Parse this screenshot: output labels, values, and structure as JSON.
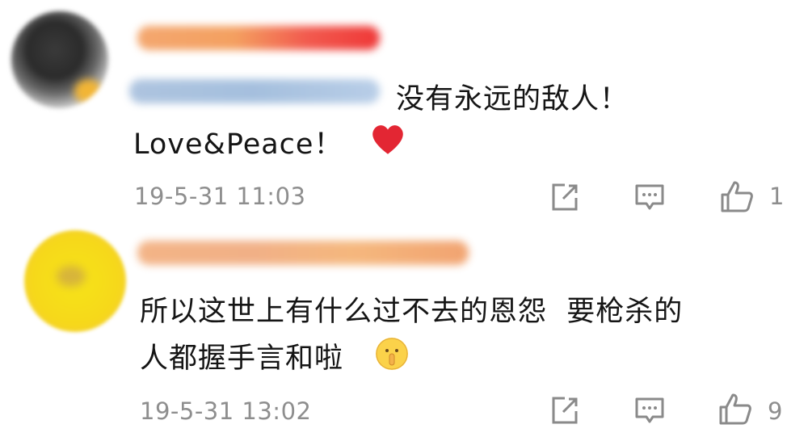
{
  "comments": [
    {
      "text_line1": "没有永远的敌人！",
      "text_line2": "Love&Peace！",
      "timestamp": "19-5-31 11:03",
      "likes": "1",
      "reaction_icon": "heart-icon"
    },
    {
      "text_line1": "所以这世上有什么过不去的恩怨  要枪杀的",
      "text_line2": "人都握手言和啦",
      "timestamp": "19-5-31 13:02",
      "likes": "9",
      "reaction_icon": "shushing-face-emoji"
    }
  ],
  "actions": [
    "share-icon",
    "reply-icon",
    "thumbs-up-icon"
  ],
  "colors": {
    "heart": "#e32633",
    "meta_gray": "#8e8e8e",
    "icon_gray": "#9a9a9a"
  }
}
